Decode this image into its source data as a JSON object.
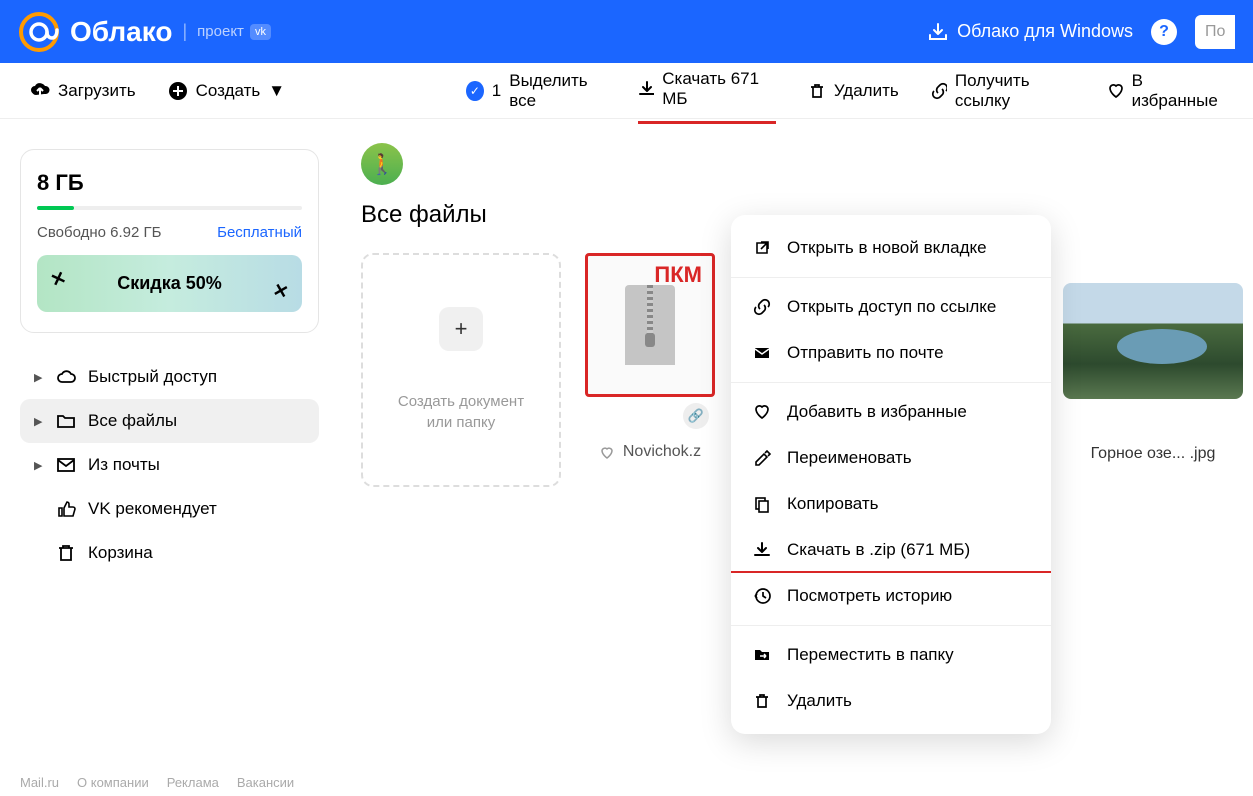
{
  "header": {
    "logo_text": "Облако",
    "project": "проект",
    "vk": "vk",
    "windows_btn": "Облако для Windows",
    "search_placeholder": "По"
  },
  "toolbar": {
    "upload": "Загрузить",
    "create": "Создать",
    "selected_count": "1",
    "select_all": "Выделить все",
    "download": "Скачать 671 МБ",
    "delete": "Удалить",
    "get_link": "Получить ссылку",
    "favorites": "В избранные"
  },
  "sidebar": {
    "storage_title": "8 ГБ",
    "storage_free": "Свободно 6.92 ГБ",
    "storage_plan": "Бесплатный",
    "promo": "Скидка 50%",
    "nav": [
      {
        "icon": "cloud",
        "label": "Быстрый доступ",
        "chevron": true
      },
      {
        "icon": "folder",
        "label": "Все файлы",
        "chevron": true,
        "active": true
      },
      {
        "icon": "mail",
        "label": "Из почты",
        "chevron": true
      },
      {
        "icon": "thumb",
        "label": "VK рекомендует",
        "chevron": false
      },
      {
        "icon": "trash",
        "label": "Корзина",
        "chevron": false
      }
    ]
  },
  "content": {
    "section_title": "Все файлы",
    "create_text_1": "Создать документ",
    "create_text_2": "или папку",
    "pkm": "ПКМ",
    "zip_name": "Novichok.z",
    "img_name": "Горное озе... .jpg"
  },
  "ctx": {
    "open_tab": "Открыть в новой вкладке",
    "share_link": "Открыть доступ по ссылке",
    "send_mail": "Отправить по почте",
    "add_fav": "Добавить в избранные",
    "rename": "Переименовать",
    "copy": "Копировать",
    "download_zip": "Скачать в .zip (671 МБ)",
    "history": "Посмотреть историю",
    "move": "Переместить в папку",
    "delete": "Удалить"
  },
  "footer": {
    "mail": "Mail.ru",
    "about": "О компании",
    "ads": "Реклама",
    "jobs": "Вакансии"
  }
}
